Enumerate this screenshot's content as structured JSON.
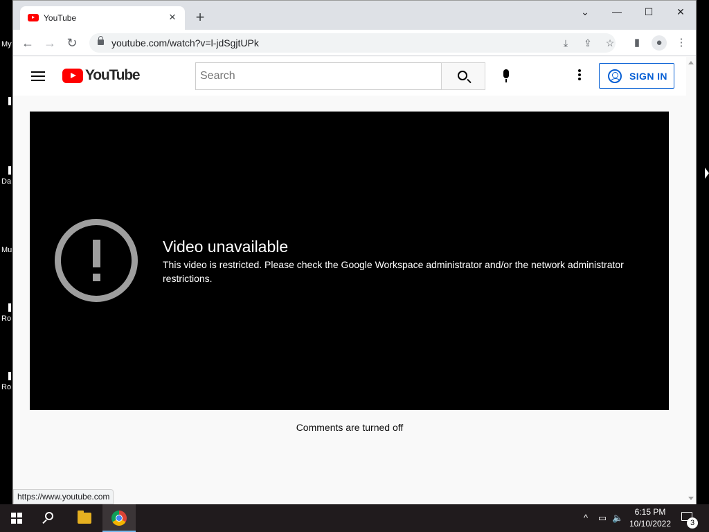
{
  "desktop": {
    "icons": [
      {
        "label": "My"
      },
      {
        "label": "I"
      },
      {
        "label": "Da"
      },
      {
        "label": "Mu"
      },
      {
        "label": "Ro"
      },
      {
        "label": "Ro"
      }
    ]
  },
  "browser": {
    "tab": {
      "title": "YouTube",
      "close_glyph": "×",
      "favicon": "youtube-icon"
    },
    "new_tab_glyph": "+",
    "window_controls": {
      "menu": "⌄",
      "minimize": "—",
      "maximize": "☐",
      "close": "✕"
    },
    "toolbar": {
      "back": "←",
      "forward": "→",
      "reload": "↻",
      "url": "youtube.com/watch?v=l-jdSgjtUPk",
      "install_glyph": "⤓",
      "share_glyph": "⇪",
      "bookmark_glyph": "☆",
      "sidepanel_glyph": "▮",
      "profile_glyph": "●",
      "menu_glyph": "⋮"
    },
    "status_url": "https://www.youtube.com"
  },
  "youtube": {
    "logo_text": "YouTube",
    "search": {
      "placeholder": "Search",
      "value": ""
    },
    "sign_in_label": "SIGN IN",
    "brand_color": "#ff0000",
    "accent_color": "#065fd4",
    "error": {
      "title": "Video unavailable",
      "message": "This video is restricted. Please check the Google Workspace administrator and/or the network administrator restrictions."
    },
    "comments_notice": "Comments are turned off"
  },
  "taskbar": {
    "tray": {
      "chevron": "^",
      "network": "▭",
      "volume": "🔈"
    },
    "clock": {
      "time": "6:15 PM",
      "date": "10/10/2022"
    },
    "notifications_count": "3"
  }
}
